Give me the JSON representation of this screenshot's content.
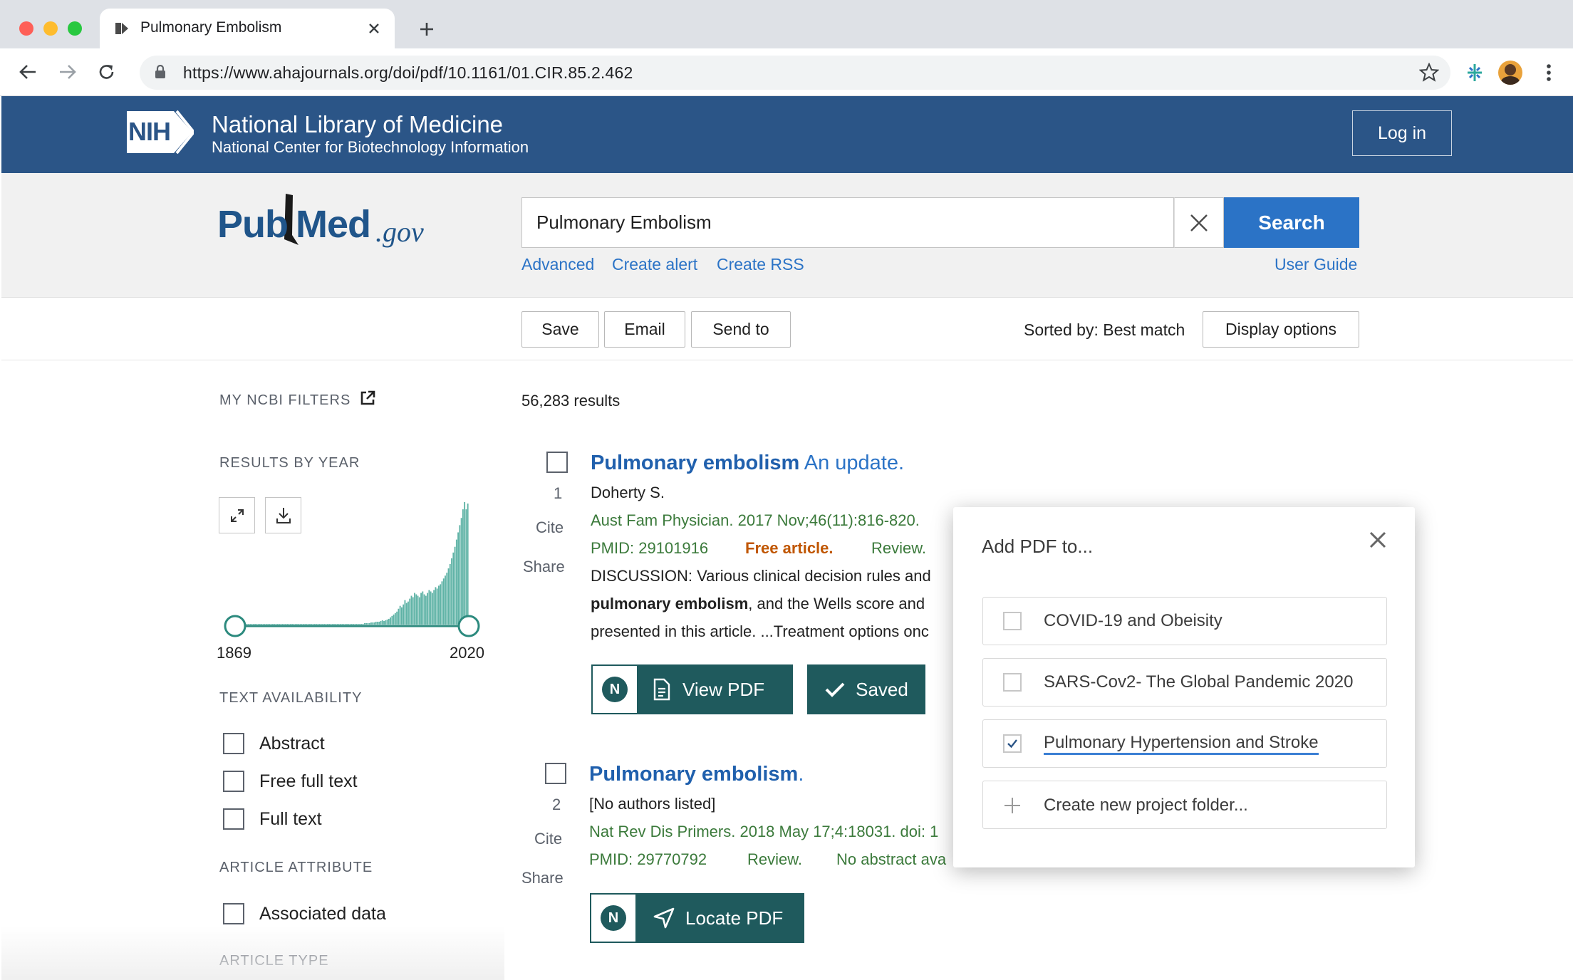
{
  "browser": {
    "tab_title": "Pulmonary Embolism",
    "url": "https://www.ahajournals.org/doi/pdf/10.1161/01.CIR.85.2.462",
    "traffic_lights": [
      "#fe5f57",
      "#febc2e",
      "#28c840"
    ]
  },
  "banner": {
    "logo_text": "NIH",
    "title": "National Library of Medicine",
    "subtitle": "National Center for Biotechnology Information",
    "login_label": "Log in",
    "color": "#2b5587"
  },
  "search": {
    "logo_pub": "Pub",
    "logo_med": "Med",
    "logo_gov": ".gov",
    "query": "Pulmonary Embolism",
    "button_label": "Search",
    "links": {
      "advanced": "Advanced",
      "create_alert": "Create alert",
      "create_rss": "Create RSS",
      "user_guide": "User Guide"
    }
  },
  "actions": {
    "save": "Save",
    "email": "Email",
    "send_to": "Send to",
    "sorted_by": "Sorted by: Best match",
    "display_options": "Display options"
  },
  "sidebar": {
    "my_filters": "MY NCBI FILTERS",
    "results_by_year": "RESULTS BY YEAR",
    "year_start": "1869",
    "year_end": "2020",
    "text_availability": "TEXT AVAILABILITY",
    "text_options": [
      "Abstract",
      "Free full text",
      "Full text"
    ],
    "article_attribute": "ARTICLE ATTRIBUTE",
    "attribute_options": [
      "Associated data"
    ],
    "article_type": "ARTICLE TYPE"
  },
  "results": {
    "count": "56,283 results",
    "items": [
      {
        "number": "1",
        "cite": "Cite",
        "share": "Share",
        "title_bold": "Pulmonary embolism",
        "title_rest": " An update.",
        "authors": "Doherty S.",
        "citation": "Aust Fam Physician. 2017 Nov;46(11):816-820.",
        "pmid": "PMID: 29101916",
        "free": "Free article.",
        "type": "Review.",
        "snippet_1": "DISCUSSION: Various clinical decision rules and",
        "snippet_2_bold": "pulmonary embolism",
        "snippet_2_rest": ", and the Wells score and",
        "snippet_3": "presented in this article. ...Treatment options onc",
        "n_badge": "N",
        "pdf_button": "View PDF",
        "saved_button": "Saved"
      },
      {
        "number": "2",
        "cite": "Cite",
        "share": "Share",
        "title_bold": "Pulmonary embolism",
        "title_rest": ".",
        "authors": "[No authors listed]",
        "citation": "Nat Rev Dis Primers. 2018 May 17;4:18031. doi: 1",
        "pmid": "PMID: 29770792",
        "type": "Review.",
        "no_abstract": "No abstract ava",
        "n_badge": "N",
        "pdf_button": "Locate PDF"
      }
    ]
  },
  "popup": {
    "title": "Add PDF to...",
    "folders": [
      {
        "label": "COVID-19 and Obeisity",
        "checked": false
      },
      {
        "label": "SARS-Cov2- The Global Pandemic 2020",
        "checked": false
      },
      {
        "label": "Pulmonary Hypertension and Stroke",
        "checked": true
      }
    ],
    "create_label": "Create new project folder..."
  },
  "year_histogram": [
    1,
    1,
    1,
    1,
    1,
    1,
    1,
    1,
    1,
    1,
    1,
    1,
    1,
    1,
    1,
    1,
    1,
    1,
    1,
    1,
    1,
    1,
    1,
    1,
    1,
    1,
    1,
    1,
    1,
    1,
    1,
    1,
    1,
    1,
    1,
    1,
    1,
    1,
    1,
    1,
    1,
    1,
    1,
    1,
    1,
    1,
    1,
    1,
    1,
    1,
    1,
    1,
    1,
    1,
    1,
    1,
    1,
    1,
    1,
    1,
    1,
    1,
    1,
    1,
    1,
    1,
    1,
    1,
    1,
    1,
    1,
    1,
    1,
    1,
    1,
    1,
    1,
    1,
    1,
    1,
    2,
    2,
    2,
    2,
    3,
    3,
    3,
    4,
    4,
    4,
    5,
    6,
    5,
    6,
    7,
    8,
    10,
    12,
    14,
    16,
    18,
    22,
    26,
    24,
    28,
    34,
    30,
    32,
    36,
    40,
    38,
    44,
    42,
    40,
    38,
    44,
    46,
    42,
    40,
    44,
    48,
    46,
    44,
    48,
    52,
    50,
    54,
    56,
    60,
    64,
    68,
    72,
    78,
    84,
    92,
    100,
    108,
    118,
    128,
    138,
    148,
    160,
    170,
    160,
    168
  ]
}
